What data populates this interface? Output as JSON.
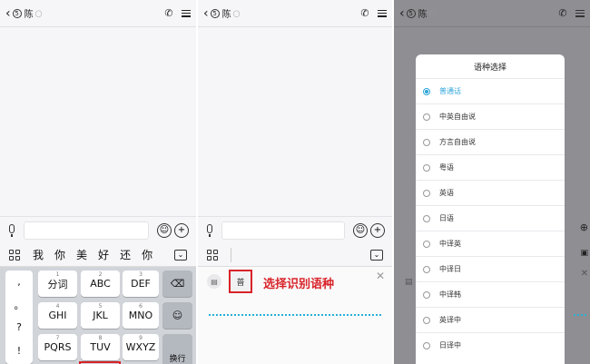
{
  "contact": {
    "badge": "5",
    "name": "陈"
  },
  "panel1": {
    "candidates": [
      "我",
      "你",
      "美",
      "好",
      "还",
      "你"
    ],
    "keys": [
      {
        "digit": "1",
        "label": "分词"
      },
      {
        "digit": "2",
        "label": "ABC"
      },
      {
        "digit": "3",
        "label": "DEF"
      },
      {
        "digit": "4",
        "label": "GHI"
      },
      {
        "digit": "5",
        "label": "JKL"
      },
      {
        "digit": "6",
        "label": "MNO"
      },
      {
        "digit": "7",
        "label": "PQRS"
      },
      {
        "digit": "8",
        "label": "TUV"
      },
      {
        "digit": "9",
        "label": "WXYZ"
      }
    ],
    "punct": [
      ",",
      "。",
      "?",
      "!"
    ],
    "enter_label": "换行"
  },
  "panel2": {
    "lang_button": "普",
    "annotation": "选择识别语种"
  },
  "panel3": {
    "dialog_title": "语种选择",
    "options": [
      {
        "label": "普通话",
        "selected": true
      },
      {
        "label": "中英自由说",
        "selected": false
      },
      {
        "label": "方言自由说",
        "selected": false
      },
      {
        "label": "粤语",
        "selected": false
      },
      {
        "label": "英语",
        "selected": false
      },
      {
        "label": "日语",
        "selected": false
      },
      {
        "label": "中译英",
        "selected": false
      },
      {
        "label": "中译日",
        "selected": false
      },
      {
        "label": "中译韩",
        "selected": false
      },
      {
        "label": "英译中",
        "selected": false
      },
      {
        "label": "日译中",
        "selected": false
      }
    ],
    "accent_color": "#2fa5d9"
  }
}
